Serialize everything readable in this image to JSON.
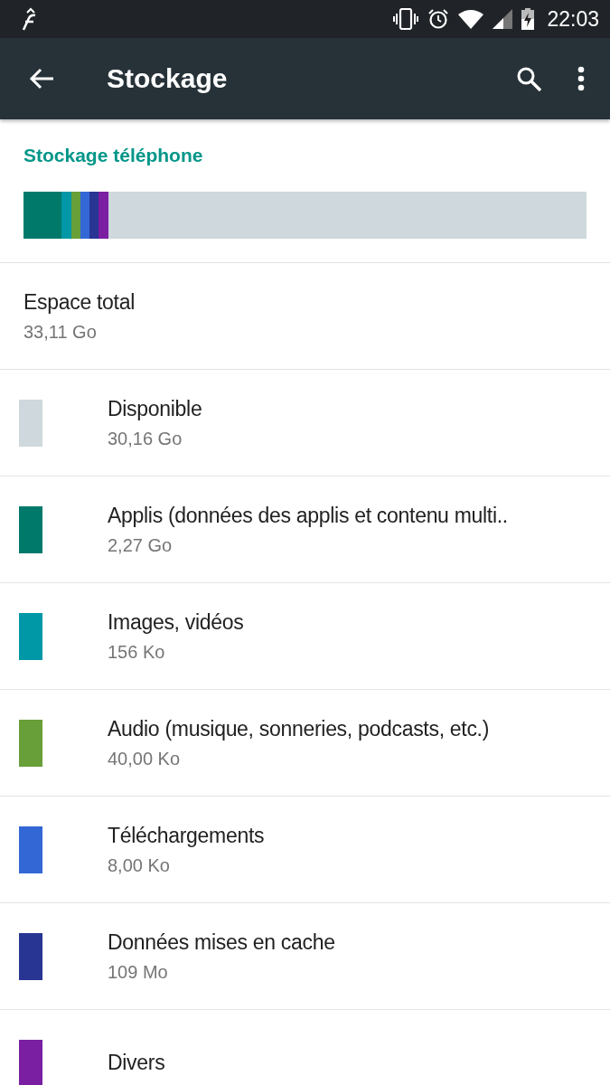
{
  "status_bar": {
    "time": "22:03"
  },
  "app_bar": {
    "title": "Stockage"
  },
  "section": {
    "title": "Stockage téléphone"
  },
  "total": {
    "label": "Espace total",
    "value": "33,11 Go"
  },
  "items": [
    {
      "label": "Disponible",
      "value": "30,16 Go",
      "color": "#cfd8dc"
    },
    {
      "label": "Applis (données des applis et contenu multi..",
      "value": "2,27 Go",
      "color": "#00796b"
    },
    {
      "label": "Images, vidéos",
      "value": "156 Ko",
      "color": "#0097a7"
    },
    {
      "label": "Audio (musique, sonneries, podcasts, etc.)",
      "value": "40,00 Ko",
      "color": "#689f38"
    },
    {
      "label": "Téléchargements",
      "value": "8,00 Ko",
      "color": "#3367d6"
    },
    {
      "label": "Données mises en cache",
      "value": "109 Mo",
      "color": "#283593"
    },
    {
      "label": "Divers",
      "color": "#7b1fa2"
    }
  ]
}
